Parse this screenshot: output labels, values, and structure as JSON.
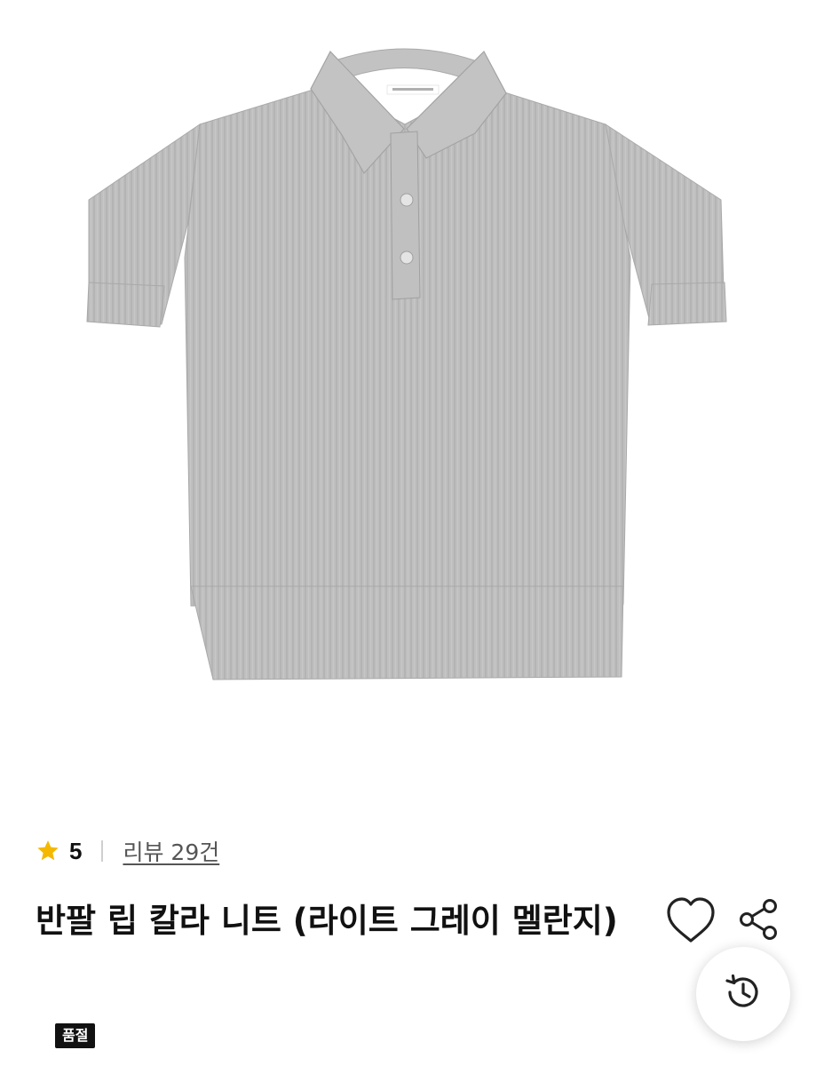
{
  "product": {
    "image_icon": "knit-polo-shirt-photo",
    "garment_color": "#bdbdbd",
    "rating": {
      "icon": "star-icon",
      "star_color": "#f5b800",
      "value": "5",
      "review_link": "리뷰 29건"
    },
    "title": "반팔 립 칼라 니트 (라이트 그레이 멜란지)",
    "actions": {
      "wishlist_icon": "heart-icon",
      "share_icon": "share-icon",
      "history_icon": "history-icon"
    },
    "badge": "품절"
  }
}
